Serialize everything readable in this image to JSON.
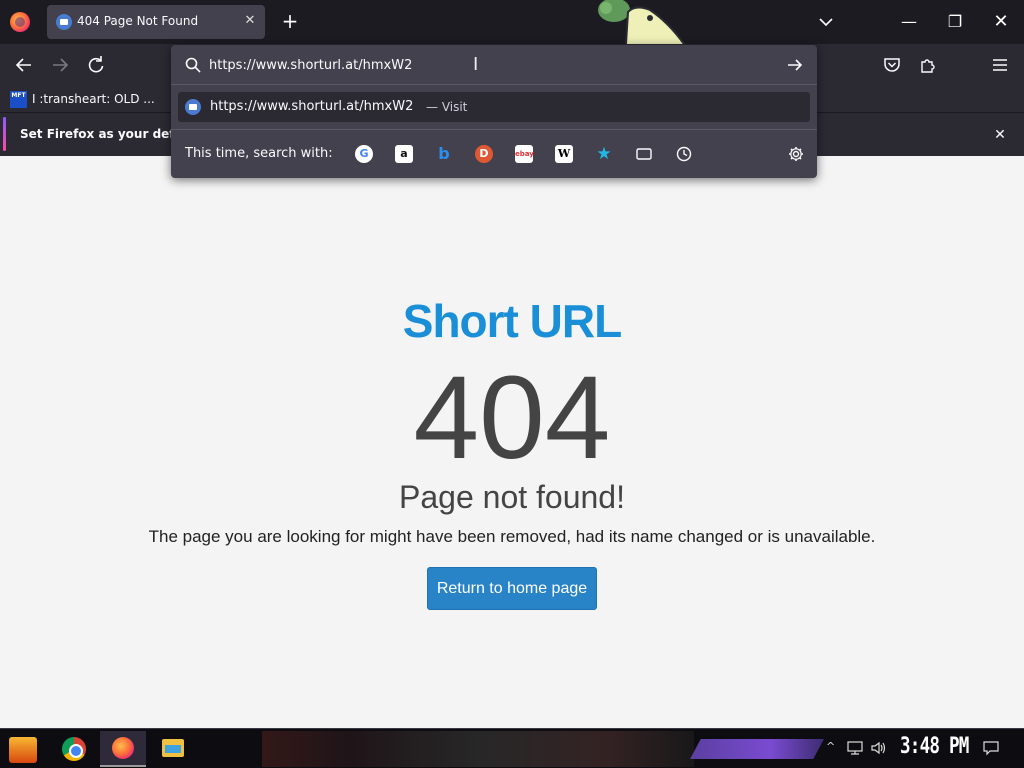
{
  "browser": {
    "tab": {
      "title": "404 Page Not Found"
    },
    "window_controls": {
      "minimize": "—",
      "maximize": "❐",
      "close": "✕"
    }
  },
  "address_bar": {
    "value": "https://www.shorturl.at/hmxW2",
    "suggestion": {
      "url": "https://www.shorturl.at/hmxW2",
      "action": "— Visit"
    },
    "search_with_label": "This time, search with:",
    "engines": [
      "google-icon",
      "amazon-icon",
      "bing-icon",
      "duckduckgo-icon",
      "ebay-icon",
      "wikipedia-icon",
      "bookmarks-icon",
      "tabs-icon",
      "history-icon"
    ]
  },
  "bookmarks_bar": {
    "items": [
      {
        "icon_text": "MFT",
        "label": "I :transheart: OLD ..."
      }
    ]
  },
  "notification": {
    "text": "Set Firefox as your defau"
  },
  "page": {
    "brand": "Short URL",
    "error_code": "404",
    "title": "Page not found!",
    "description": "The page you are looking for might have been removed, had its name changed or is unavailable.",
    "home_button": "Return to home page",
    "colors": {
      "brand": "#1a8fd8",
      "button": "#2984c7",
      "text": "#444444"
    }
  },
  "taskbar": {
    "clock": "3:48 PM"
  }
}
